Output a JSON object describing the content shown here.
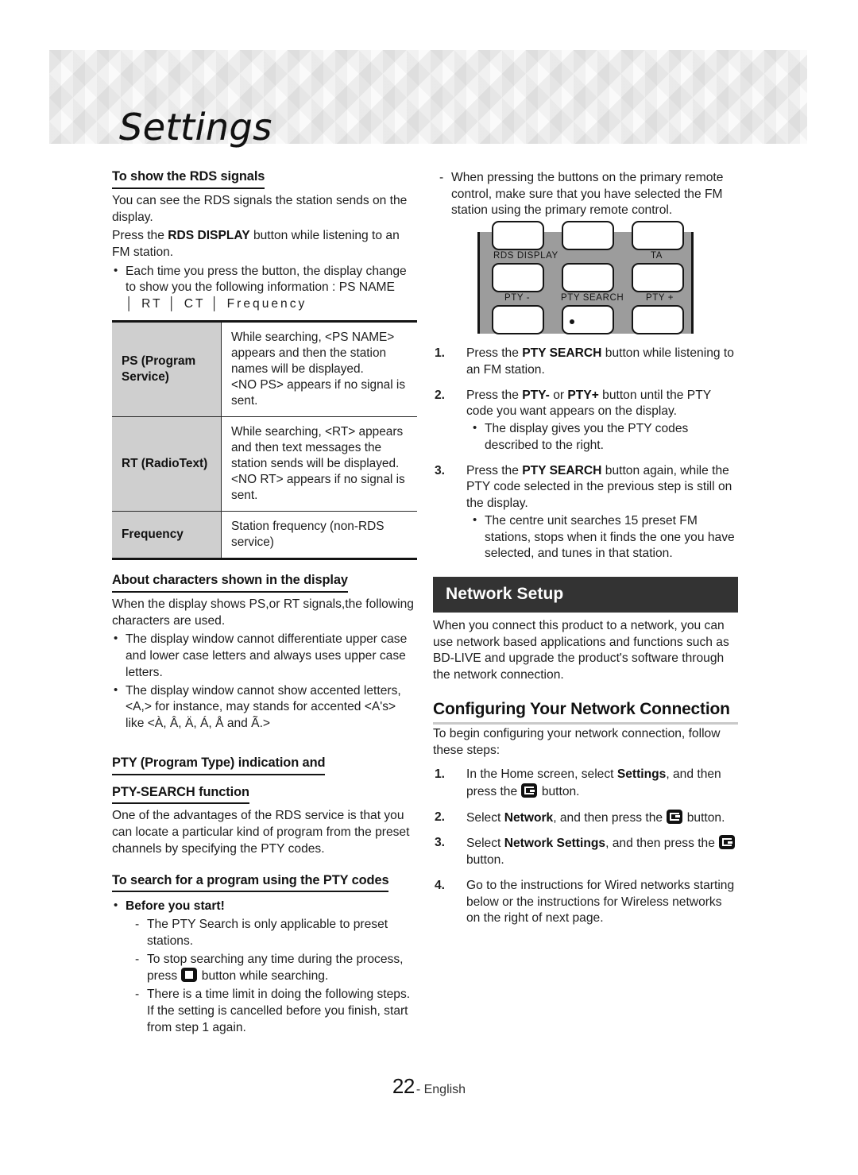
{
  "page": {
    "title": "Settings",
    "footer_number": "22",
    "footer_lang": "- English"
  },
  "colors": {
    "banner_bg": "#333333",
    "table_header_bg": "#cfcfcf",
    "remote_body": "#9c9c9c",
    "heading_rule": "#c9c9c9"
  },
  "left_column": {
    "heading_rds": "To show the RDS signals",
    "rds_p1": "You can see the RDS signals the station sends on the display.",
    "rds_p2_pre": "Press the ",
    "rds_p2_bold": "RDS DISPLAY",
    "rds_p2_post": " button while listening to an FM station.",
    "rds_bullet": "Each time you press the button, the display change to show you the following information : PS NAME",
    "rds_bullet_chain": "│ RT │ CT │ Frequency",
    "table": {
      "rows": [
        {
          "label": "PS (Program Service)",
          "desc_line1": "While searching, <PS NAME> appears and then the station names will be displayed.",
          "desc_line2": "<NO PS> appears if no signal is sent."
        },
        {
          "label": "RT (RadioText)",
          "desc_line1": "While searching, <RT> appears and then text messages the station sends will be displayed.",
          "desc_line2": "<NO RT> appears if no signal is sent."
        },
        {
          "label": "Frequency",
          "desc_line1": "Station frequency (non-RDS service)",
          "desc_line2": ""
        }
      ]
    },
    "heading_chars": "About characters shown in the display",
    "chars_p1": "When the display shows PS,or RT signals,the following characters are used.",
    "chars_bullet1": "The display window cannot differentiate upper case and lower case letters and always uses upper case letters.",
    "chars_bullet2": "The display window cannot show accented letters, <A,> for instance, may stands for accented <A's> like <À, Â, Ä, Á, Å and Ã.>",
    "heading_pty_1": "PTY (Program Type) indication and",
    "heading_pty_2": "PTY-SEARCH function",
    "pty_p1": "One of the advantages of the RDS service is that you can locate a particular kind of program from the preset channels by specifying the PTY codes.",
    "heading_search": "To search for a program using the PTY codes",
    "before_you_start": "Before you start!",
    "before_items": [
      "The PTY Search is only applicable to preset stations.",
      "There is a time limit in doing the following steps. If the setting is cancelled before you finish, start from step 1 again."
    ],
    "stop_item_pre": "To stop searching any time during the process, press ",
    "stop_item_post": " button while searching."
  },
  "right_column": {
    "note_dash": "When pressing the buttons on the primary remote control, make sure that you have selected the FM station using the primary remote control.",
    "remote": {
      "label_rds_display": "RDS DISPLAY",
      "label_ta": "TA",
      "label_pty_minus": "PTY -",
      "label_pty_search": "PTY SEARCH",
      "label_pty_plus": "PTY +"
    },
    "pty_steps": [
      {
        "num": "1.",
        "pre": "Press the ",
        "bold": "PTY SEARCH",
        "post": " button while listening to an FM station.",
        "sub": []
      },
      {
        "num": "2.",
        "pre": "Press the ",
        "bold": "PTY-",
        "mid": " or ",
        "bold2": "PTY+",
        "post": " button until the PTY code you want appears on the display.",
        "sub": [
          "The display gives you the PTY codes described to the right."
        ]
      },
      {
        "num": "3.",
        "pre": "Press the ",
        "bold": "PTY SEARCH",
        "post": " button again, while the PTY code selected in the previous step is still on the display.",
        "sub": [
          "The centre unit searches 15 preset FM stations, stops when it finds the one you have selected, and tunes in that station."
        ]
      }
    ],
    "banner_network_setup": "Network Setup",
    "network_p1": "When you connect this product to a network, you can use network based applications and functions such as BD-LIVE and upgrade the product's software through the network connection.",
    "heading_configuring": "Configuring Your Network Connection",
    "configuring_p1": "To begin configuring your network connection, follow these steps:",
    "net_steps": [
      {
        "num": "1.",
        "pre": "In the Home screen, select ",
        "bold": "Settings",
        "mid": ", and then press the ",
        "post": " button."
      },
      {
        "num": "2.",
        "pre": "Select ",
        "bold": "Network",
        "mid": ", and then press the ",
        "post": " button."
      },
      {
        "num": "3.",
        "pre": "Select ",
        "bold": "Network Settings",
        "mid": ", and then press the ",
        "post": " button."
      },
      {
        "num": "4.",
        "pre": "Go to the instructions for Wired networks starting below or the instructions for Wireless networks on the right of next page.",
        "bold": "",
        "mid": "",
        "post": ""
      }
    ]
  }
}
